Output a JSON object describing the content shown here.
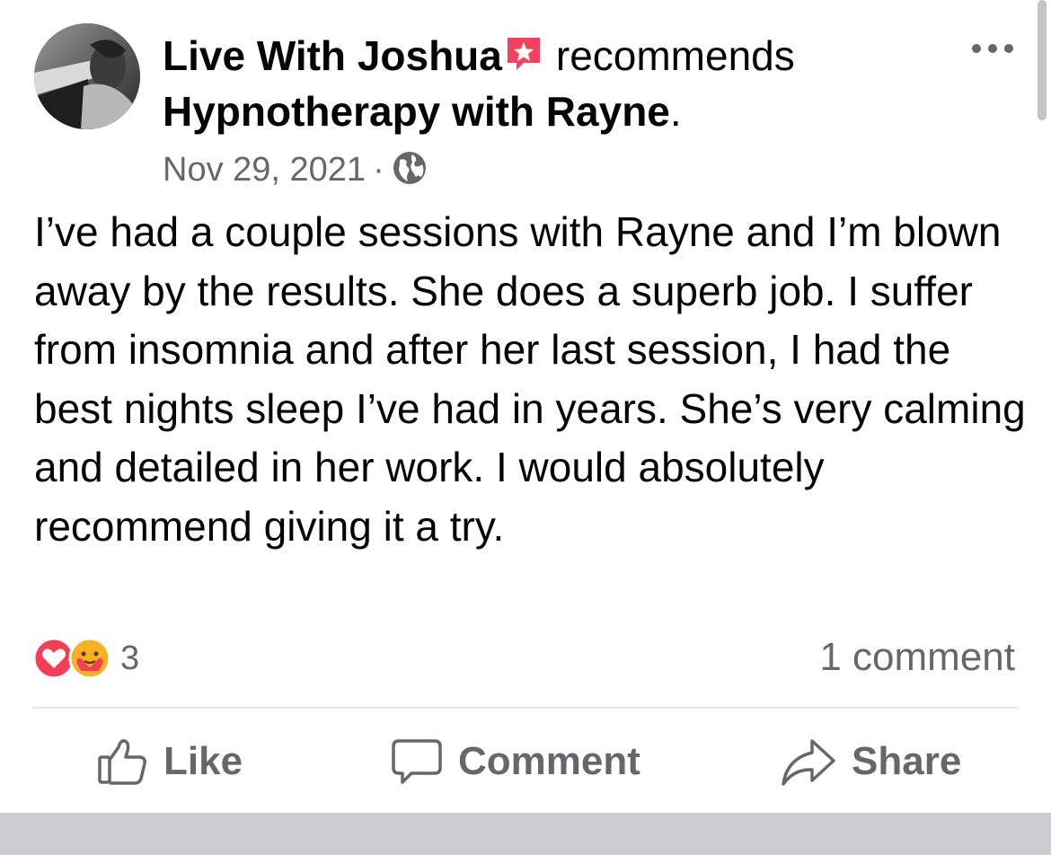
{
  "post": {
    "author": "Live With Joshua",
    "action_text": "recommends",
    "target": "Hypnotherapy with Rayne",
    "target_suffix": ".",
    "date": "Nov 29, 2021",
    "separator": "·",
    "privacy_icon": "globe-icon",
    "text": "I’ve had a couple sessions with Rayne and I’m blown away by the results. She does a superb job. I suffer from insomnia and after her last session, I had the best nights sleep I’ve had in years. She’s very calming and detailed in her work. I would absolutely recommend giving it a try."
  },
  "reactions": {
    "icons": [
      "love-reaction-icon",
      "care-reaction-icon"
    ],
    "count": "3"
  },
  "comments_label": "1 comment",
  "actions": {
    "like": "Like",
    "comment": "Comment",
    "share": "Share"
  },
  "colors": {
    "recommend_badge": "#f3425f",
    "secondary_text": "#65676b",
    "love": "#f33e58",
    "care": "#f7b125"
  }
}
